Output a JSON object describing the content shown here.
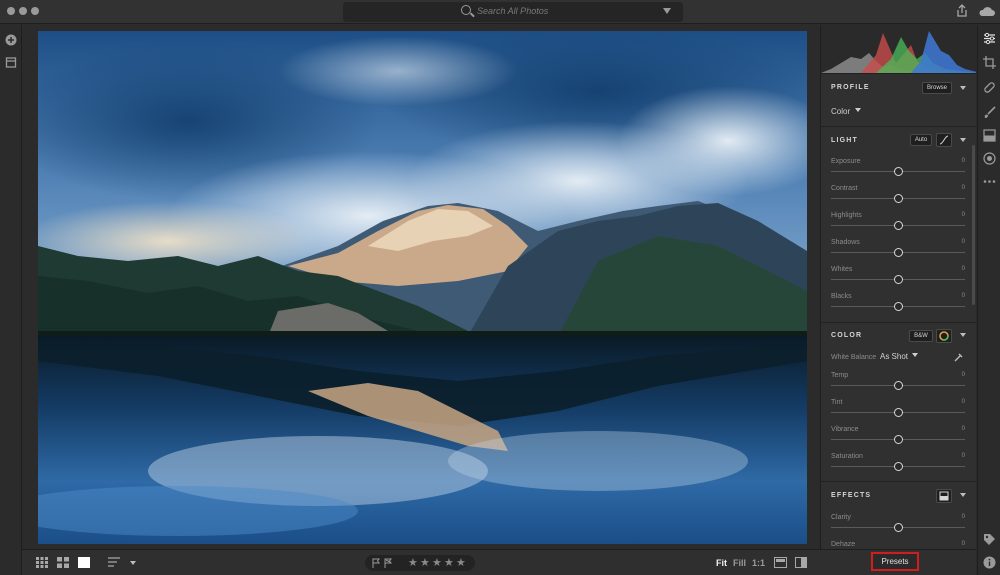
{
  "topbar": {
    "search_placeholder": "Search All Photos"
  },
  "profile": {
    "heading": "PROFILE",
    "browse_label": "Browse",
    "current": "Color"
  },
  "light": {
    "heading": "LIGHT",
    "auto_label": "Auto",
    "sliders": [
      {
        "label": "Exposure",
        "value": "0",
        "level": 0.5
      },
      {
        "label": "Contrast",
        "value": "0",
        "level": 0.5
      },
      {
        "label": "Highlights",
        "value": "0",
        "level": 0.5
      },
      {
        "label": "Shadows",
        "value": "0",
        "level": 0.5
      },
      {
        "label": "Whites",
        "value": "0",
        "level": 0.5
      },
      {
        "label": "Blacks",
        "value": "0",
        "level": 0.5
      }
    ]
  },
  "color": {
    "heading": "COLOR",
    "bw_label": "B&W",
    "white_balance_label": "White Balance",
    "white_balance_value": "As Shot",
    "sliders": [
      {
        "label": "Temp",
        "value": "0",
        "level": 0.5
      },
      {
        "label": "Tint",
        "value": "0",
        "level": 0.5
      },
      {
        "label": "Vibrance",
        "value": "0",
        "level": 0.5
      },
      {
        "label": "Saturation",
        "value": "0",
        "level": 0.5
      }
    ]
  },
  "effects": {
    "heading": "EFFECTS",
    "sliders": [
      {
        "label": "Clarity",
        "value": "0",
        "level": 0.5
      },
      {
        "label": "Dehaze",
        "value": "0",
        "level": 0.5
      }
    ]
  },
  "bottombar": {
    "zoom_fit": "Fit",
    "zoom_fill": "Fill",
    "zoom_1to1": "1:1",
    "star_glyph": "★",
    "rating": 0
  },
  "presets_label": "Presets",
  "colors": {
    "accent_red": "#d01d1d",
    "panel_bg": "#303030",
    "app_bg": "#2b2b2b"
  },
  "icons": {
    "topbar": [
      "search-icon",
      "filter-icon",
      "share-icon",
      "cloud-icon"
    ],
    "left_strip": [
      "add-photos-icon",
      "library-icon"
    ],
    "right_strip": [
      "edit-sliders-icon",
      "crop-icon",
      "healing-icon",
      "brush-icon",
      "linear-gradient-icon",
      "radial-gradient-icon",
      "more-icon",
      "tag-icon",
      "info-icon"
    ],
    "bottom_left": [
      "square-grid-icon",
      "photo-grid-icon",
      "detail-view-icon",
      "sort-icon"
    ],
    "bottom_right": [
      "compare-icon",
      "split-view-icon"
    ]
  }
}
